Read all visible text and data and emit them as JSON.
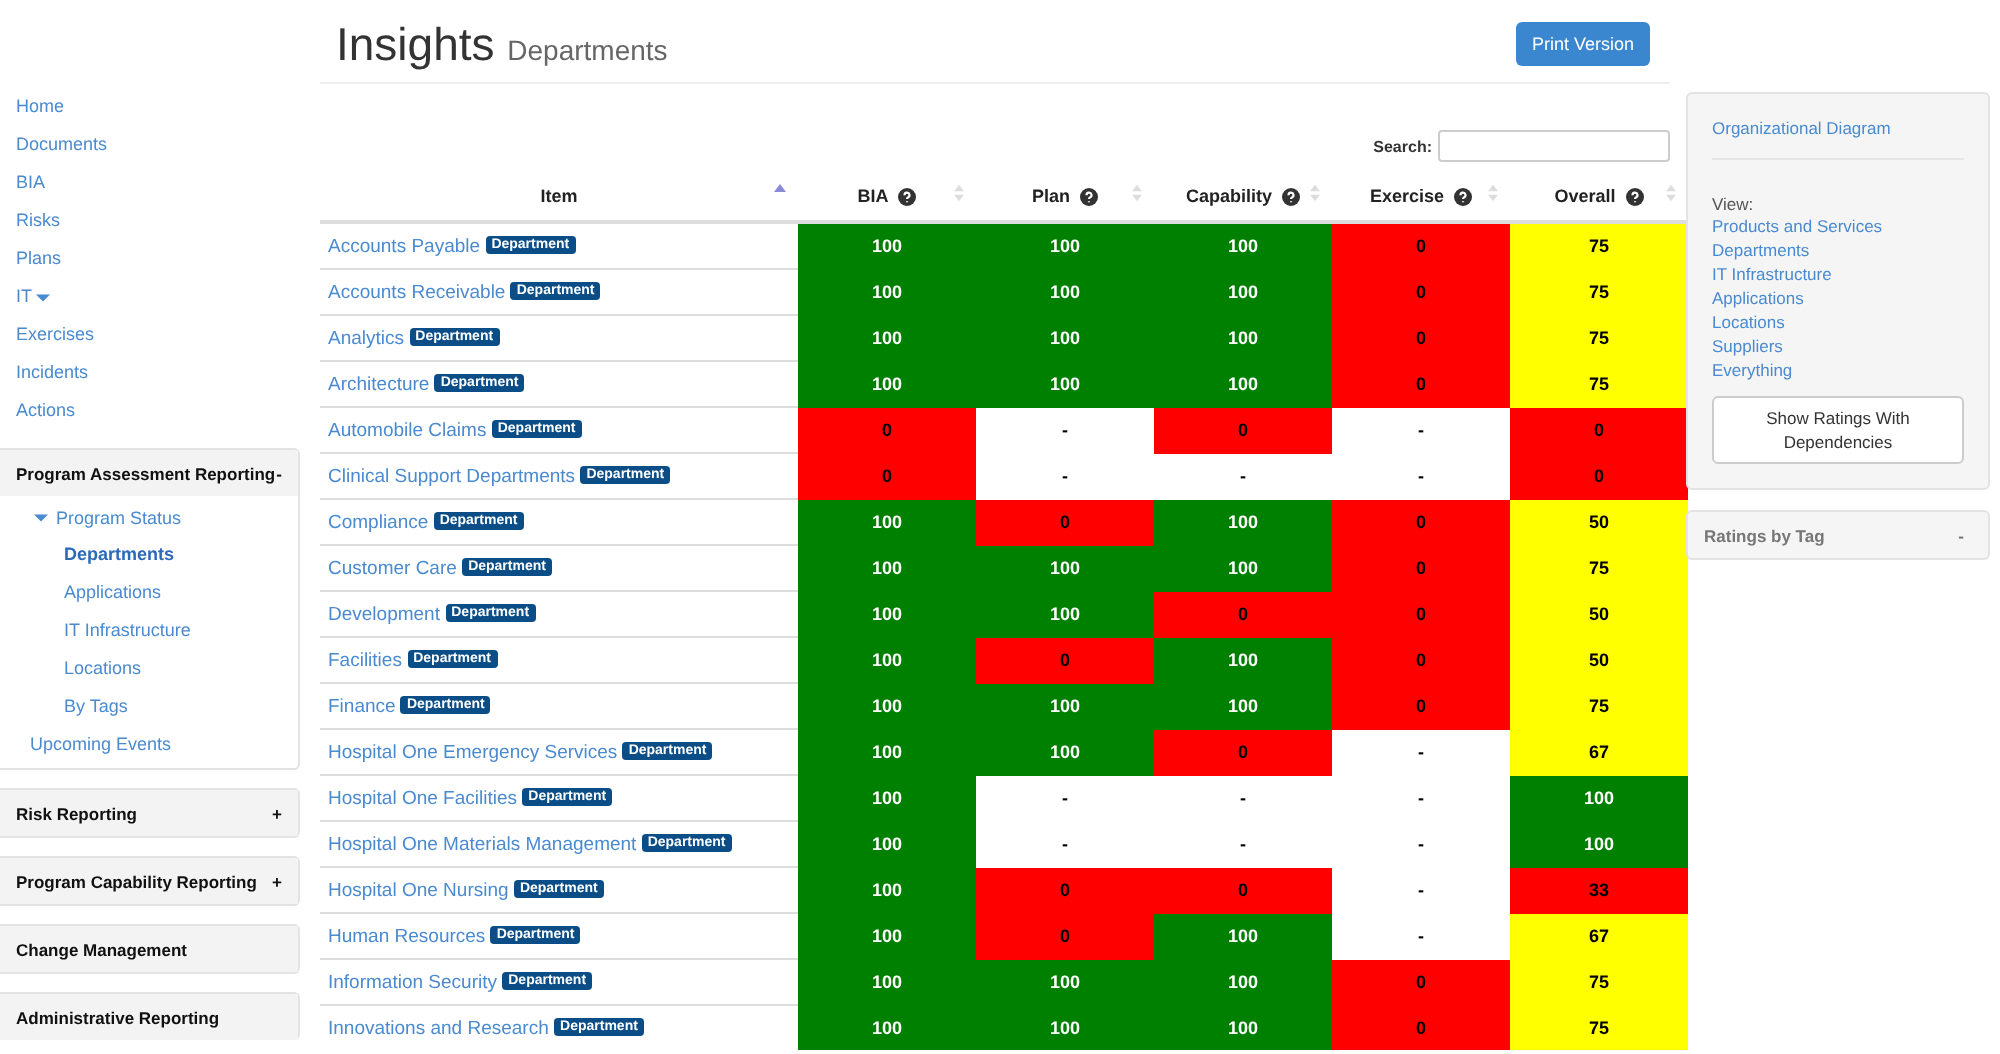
{
  "nav": {
    "links": [
      "Home",
      "Documents",
      "BIA",
      "Risks",
      "Plans",
      "IT",
      "Exercises",
      "Incidents",
      "Actions"
    ],
    "panels": [
      {
        "title": "Program Assessment Reporting",
        "toggle": "-",
        "tree": {
          "label": "Program Status",
          "children": [
            {
              "label": "Departments",
              "selected": true
            },
            {
              "label": "Applications",
              "selected": false
            },
            {
              "label": "IT Infrastructure",
              "selected": false
            },
            {
              "label": "Locations",
              "selected": false
            },
            {
              "label": "By Tags",
              "selected": false
            }
          ]
        },
        "extra": "Upcoming Events"
      },
      {
        "title": "Risk Reporting",
        "toggle": "+"
      },
      {
        "title": "Program Capability Reporting",
        "toggle": "+"
      },
      {
        "title": "Change Management"
      },
      {
        "title": "Administrative Reporting"
      }
    ]
  },
  "header": {
    "title": "Insights",
    "subtitle": "Departments",
    "print_button": "Print Version"
  },
  "search": {
    "label": "Search:"
  },
  "table": {
    "item_column": {
      "label": "Item",
      "sorted": true
    },
    "columns": [
      {
        "label": "BIA",
        "help": true,
        "sorted": false
      },
      {
        "label": "Plan",
        "help": true,
        "sorted": false
      },
      {
        "label": "Capability",
        "help": true,
        "sorted": false
      },
      {
        "label": "Exercise",
        "help": true,
        "sorted": false
      },
      {
        "label": "Overall",
        "help": true,
        "sorted": false
      }
    ],
    "rows": [
      {
        "name": "Accounts Payable",
        "tag": "Department",
        "cells": [
          {
            "text": "100",
            "color": "#008000"
          },
          {
            "text": "100",
            "color": "#008000"
          },
          {
            "text": "100",
            "color": "#008000"
          },
          {
            "text": "0",
            "color": "#ff0000"
          },
          {
            "text": "75",
            "color": "#ffff00"
          }
        ]
      },
      {
        "name": "Accounts Receivable",
        "tag": "Department",
        "cells": [
          {
            "text": "100",
            "color": "#008000"
          },
          {
            "text": "100",
            "color": "#008000"
          },
          {
            "text": "100",
            "color": "#008000"
          },
          {
            "text": "0",
            "color": "#ff0000"
          },
          {
            "text": "75",
            "color": "#ffff00"
          }
        ]
      },
      {
        "name": "Analytics",
        "tag": "Department",
        "cells": [
          {
            "text": "100",
            "color": "#008000"
          },
          {
            "text": "100",
            "color": "#008000"
          },
          {
            "text": "100",
            "color": "#008000"
          },
          {
            "text": "0",
            "color": "#ff0000"
          },
          {
            "text": "75",
            "color": "#ffff00"
          }
        ]
      },
      {
        "name": "Architecture",
        "tag": "Department",
        "cells": [
          {
            "text": "100",
            "color": "#008000"
          },
          {
            "text": "100",
            "color": "#008000"
          },
          {
            "text": "100",
            "color": "#008000"
          },
          {
            "text": "0",
            "color": "#ff0000"
          },
          {
            "text": "75",
            "color": "#ffff00"
          }
        ]
      },
      {
        "name": "Automobile Claims",
        "tag": "Department",
        "cells": [
          {
            "text": "0",
            "color": "#ff0000"
          },
          {
            "text": "-",
            "color": "#ffffff"
          },
          {
            "text": "0",
            "color": "#ff0000"
          },
          {
            "text": "-",
            "color": "#ffffff"
          },
          {
            "text": "0",
            "color": "#ff0000"
          }
        ]
      },
      {
        "name": "Clinical Support Departments",
        "tag": "Department",
        "cells": [
          {
            "text": "0",
            "color": "#ff0000"
          },
          {
            "text": "-",
            "color": "#ffffff"
          },
          {
            "text": "-",
            "color": "#ffffff"
          },
          {
            "text": "-",
            "color": "#ffffff"
          },
          {
            "text": "0",
            "color": "#ff0000"
          }
        ]
      },
      {
        "name": "Compliance",
        "tag": "Department",
        "cells": [
          {
            "text": "100",
            "color": "#008000"
          },
          {
            "text": "0",
            "color": "#ff0000"
          },
          {
            "text": "100",
            "color": "#008000"
          },
          {
            "text": "0",
            "color": "#ff0000"
          },
          {
            "text": "50",
            "color": "#ffff00"
          }
        ]
      },
      {
        "name": "Customer Care",
        "tag": "Department",
        "cells": [
          {
            "text": "100",
            "color": "#008000"
          },
          {
            "text": "100",
            "color": "#008000"
          },
          {
            "text": "100",
            "color": "#008000"
          },
          {
            "text": "0",
            "color": "#ff0000"
          },
          {
            "text": "75",
            "color": "#ffff00"
          }
        ]
      },
      {
        "name": "Development",
        "tag": "Department",
        "cells": [
          {
            "text": "100",
            "color": "#008000"
          },
          {
            "text": "100",
            "color": "#008000"
          },
          {
            "text": "0",
            "color": "#ff0000"
          },
          {
            "text": "0",
            "color": "#ff0000"
          },
          {
            "text": "50",
            "color": "#ffff00"
          }
        ]
      },
      {
        "name": "Facilities",
        "tag": "Department",
        "cells": [
          {
            "text": "100",
            "color": "#008000"
          },
          {
            "text": "0",
            "color": "#ff0000"
          },
          {
            "text": "100",
            "color": "#008000"
          },
          {
            "text": "0",
            "color": "#ff0000"
          },
          {
            "text": "50",
            "color": "#ffff00"
          }
        ]
      },
      {
        "name": "Finance",
        "tag": "Department",
        "cells": [
          {
            "text": "100",
            "color": "#008000"
          },
          {
            "text": "100",
            "color": "#008000"
          },
          {
            "text": "100",
            "color": "#008000"
          },
          {
            "text": "0",
            "color": "#ff0000"
          },
          {
            "text": "75",
            "color": "#ffff00"
          }
        ]
      },
      {
        "name": "Hospital One Emergency Services",
        "tag": "Department",
        "cells": [
          {
            "text": "100",
            "color": "#008000"
          },
          {
            "text": "100",
            "color": "#008000"
          },
          {
            "text": "0",
            "color": "#ff0000"
          },
          {
            "text": "-",
            "color": "#ffffff"
          },
          {
            "text": "67",
            "color": "#ffff00"
          }
        ]
      },
      {
        "name": "Hospital One Facilities",
        "tag": "Department",
        "cells": [
          {
            "text": "100",
            "color": "#008000"
          },
          {
            "text": "-",
            "color": "#ffffff"
          },
          {
            "text": "-",
            "color": "#ffffff"
          },
          {
            "text": "-",
            "color": "#ffffff"
          },
          {
            "text": "100",
            "color": "#008000"
          }
        ]
      },
      {
        "name": "Hospital One Materials Management",
        "tag": "Department",
        "cells": [
          {
            "text": "100",
            "color": "#008000"
          },
          {
            "text": "-",
            "color": "#ffffff"
          },
          {
            "text": "-",
            "color": "#ffffff"
          },
          {
            "text": "-",
            "color": "#ffffff"
          },
          {
            "text": "100",
            "color": "#008000"
          }
        ]
      },
      {
        "name": "Hospital One Nursing",
        "tag": "Department",
        "cells": [
          {
            "text": "100",
            "color": "#008000"
          },
          {
            "text": "0",
            "color": "#ff0000"
          },
          {
            "text": "0",
            "color": "#ff0000"
          },
          {
            "text": "-",
            "color": "#ffffff"
          },
          {
            "text": "33",
            "color": "#ff0000"
          }
        ]
      },
      {
        "name": "Human Resources",
        "tag": "Department",
        "cells": [
          {
            "text": "100",
            "color": "#008000"
          },
          {
            "text": "0",
            "color": "#ff0000"
          },
          {
            "text": "100",
            "color": "#008000"
          },
          {
            "text": "-",
            "color": "#ffffff"
          },
          {
            "text": "67",
            "color": "#ffff00"
          }
        ]
      },
      {
        "name": "Information Security",
        "tag": "Department",
        "cells": [
          {
            "text": "100",
            "color": "#008000"
          },
          {
            "text": "100",
            "color": "#008000"
          },
          {
            "text": "100",
            "color": "#008000"
          },
          {
            "text": "0",
            "color": "#ff0000"
          },
          {
            "text": "75",
            "color": "#ffff00"
          }
        ]
      },
      {
        "name": "Innovations and Research",
        "tag": "Department",
        "cells": [
          {
            "text": "100",
            "color": "#008000"
          },
          {
            "text": "100",
            "color": "#008000"
          },
          {
            "text": "100",
            "color": "#008000"
          },
          {
            "text": "0",
            "color": "#ff0000"
          },
          {
            "text": "75",
            "color": "#ffff00"
          }
        ]
      }
    ]
  },
  "side": {
    "diagram_link": "Organizational Diagram",
    "view_label": "View:",
    "view_links": [
      "Products and Services",
      "Departments",
      "IT Infrastructure",
      "Applications",
      "Locations",
      "Suppliers",
      "Everything"
    ],
    "dependencies_button": "Show Ratings With Dependencies",
    "tag_panel": {
      "title": "Ratings by Tag",
      "toggle": "-"
    }
  }
}
